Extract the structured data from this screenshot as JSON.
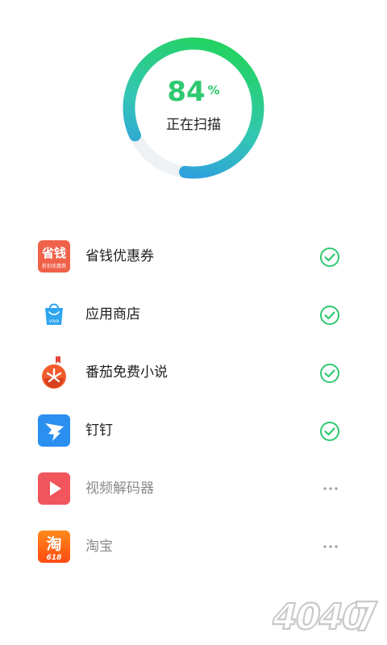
{
  "scan": {
    "percent": "84",
    "percent_unit": "%",
    "status": "正在扫描",
    "progress": 0.84,
    "ring_gradient": [
      "#1ed64a",
      "#33c6b4",
      "#2e8ff0"
    ]
  },
  "apps": [
    {
      "name": "省钱优惠券",
      "icon": "coupon-icon",
      "icon_text": "省钱",
      "icon_subtext": "折扣优惠券",
      "state": "done"
    },
    {
      "name": "应用商店",
      "icon": "shopping-bag-icon",
      "icon_text": "vivo",
      "state": "done"
    },
    {
      "name": "番茄免费小说",
      "icon": "tomato-icon",
      "state": "done"
    },
    {
      "name": "钉钉",
      "icon": "dingtalk-icon",
      "state": "done"
    },
    {
      "name": "视频解码器",
      "icon": "play-icon",
      "state": "pending"
    },
    {
      "name": "淘宝",
      "icon": "taobao-icon",
      "icon_text": "淘",
      "icon_subtext": "618",
      "state": "pending"
    }
  ],
  "colors": {
    "check": "#2ec970",
    "pending_dots": "#9a9a9a"
  },
  "watermark": {
    "text": "4040",
    "icon": "watermark-logo"
  }
}
